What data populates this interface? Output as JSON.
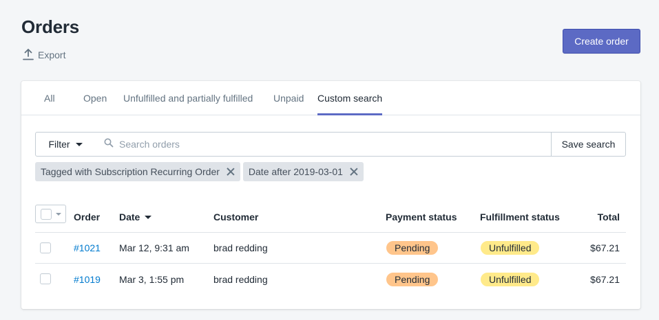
{
  "page": {
    "title": "Orders",
    "export_label": "Export",
    "create_order_label": "Create order",
    "accent_color": "#5c6ac4"
  },
  "tabs": [
    {
      "label": "All",
      "active": false
    },
    {
      "label": "Open",
      "active": false
    },
    {
      "label": "Unfulfilled and partially fulfilled",
      "active": false
    },
    {
      "label": "Unpaid",
      "active": false
    },
    {
      "label": "Custom search",
      "active": true
    }
  ],
  "filters": {
    "filter_label": "Filter",
    "search_placeholder": "Search orders",
    "search_value": "",
    "save_search_label": "Save search",
    "applied": [
      {
        "label": "Tagged with Subscription Recurring Order"
      },
      {
        "label": "Date after 2019-03-01"
      }
    ]
  },
  "table": {
    "columns": [
      "Order",
      "Date",
      "Customer",
      "Payment status",
      "Fulfillment status",
      "Total"
    ],
    "sort_column": "Date",
    "rows": [
      {
        "order": "#1021",
        "date": "Mar 12, 9:31 am",
        "customer": "brad redding",
        "payment_status": "Pending",
        "fulfillment_status": "Unfulfilled",
        "total": "$67.21"
      },
      {
        "order": "#1019",
        "date": "Mar 3, 1:55 pm",
        "customer": "brad redding",
        "payment_status": "Pending",
        "fulfillment_status": "Unfulfilled",
        "total": "$67.21"
      }
    ]
  },
  "status_colors": {
    "pending": "#ffc58b",
    "unfulfilled": "#ffea8a"
  }
}
